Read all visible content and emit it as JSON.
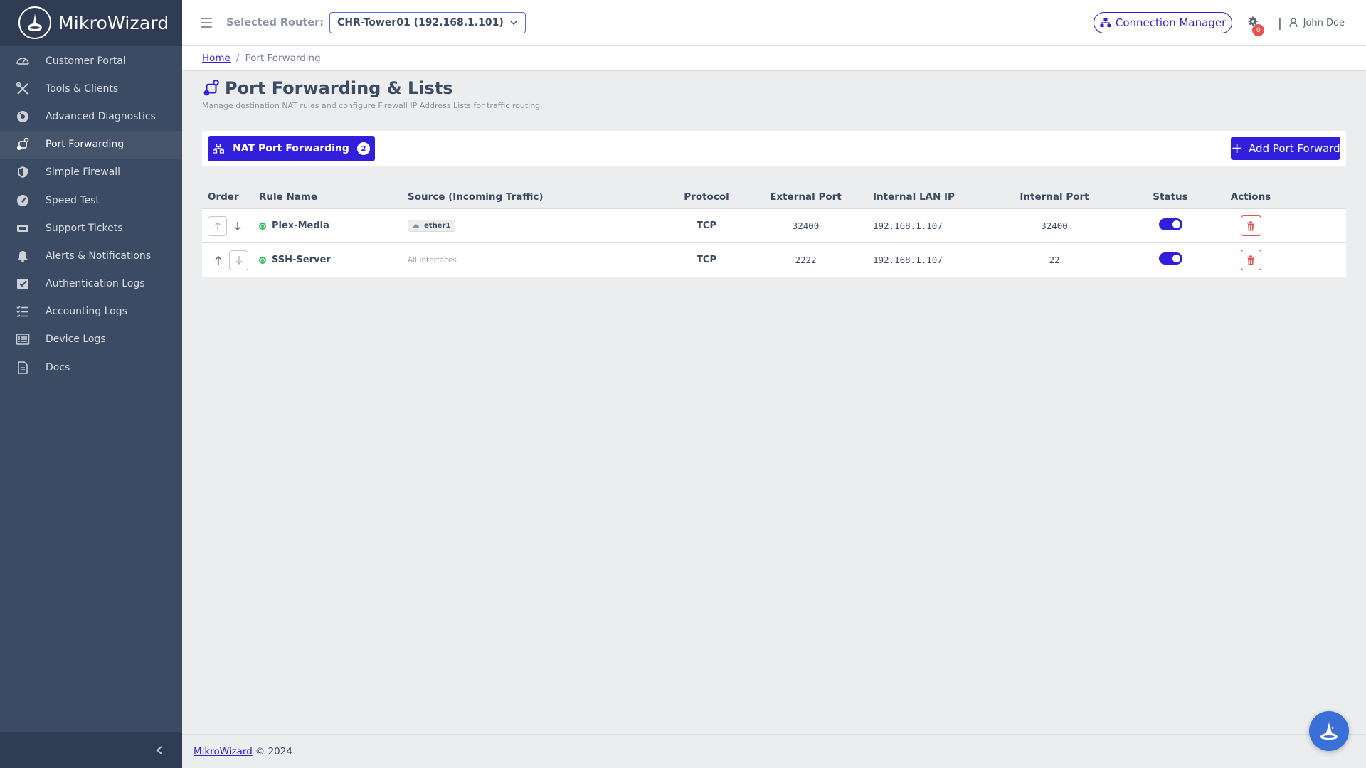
{
  "app": {
    "name": "MikroWizard"
  },
  "sidebar": {
    "items": [
      {
        "label": "Customer Portal",
        "icon": "speedometer-icon"
      },
      {
        "label": "Tools & Clients",
        "icon": "tools-icon"
      },
      {
        "label": "Advanced Diagnostics",
        "icon": "diagnostics-icon"
      },
      {
        "label": "Port Forwarding",
        "icon": "route-icon",
        "active": true
      },
      {
        "label": "Simple Firewall",
        "icon": "shield-icon"
      },
      {
        "label": "Speed Test",
        "icon": "gauge-icon"
      },
      {
        "label": "Support Tickets",
        "icon": "ticket-icon"
      },
      {
        "label": "Alerts & Notifications",
        "icon": "bell-icon"
      },
      {
        "label": "Authentication Logs",
        "icon": "auth-log-icon"
      },
      {
        "label": "Accounting Logs",
        "icon": "list-check-icon"
      },
      {
        "label": "Device Logs",
        "icon": "list-icon"
      },
      {
        "label": "Docs",
        "icon": "document-icon"
      }
    ]
  },
  "header": {
    "router_label": "Selected Router:",
    "router_value": "CHR-Tower01 (192.168.1.101)",
    "connection_manager": "Connection Manager",
    "notification_count": "0",
    "separator": "|",
    "user_name": "John Doe"
  },
  "breadcrumb": {
    "home": "Home",
    "separator": "/",
    "current": "Port Forwarding"
  },
  "page": {
    "title": "Port Forwarding & Lists",
    "subtitle": "Manage destination NAT rules and configure Firewall IP Address Lists for traffic routing."
  },
  "tabs": {
    "nat_label": "NAT Port Forwarding",
    "nat_count": "2",
    "add_label": "Add Port Forward"
  },
  "table": {
    "headers": {
      "order": "Order",
      "name": "Rule Name",
      "source": "Source (Incoming Traffic)",
      "protocol": "Protocol",
      "external_port": "External Port",
      "internal_ip": "Internal LAN IP",
      "internal_port": "Internal Port",
      "status": "Status",
      "actions": "Actions"
    },
    "rows": [
      {
        "name": "Plex-Media",
        "source": "ether1",
        "source_type": "interface",
        "protocol": "TCP",
        "external_port": "32400",
        "internal_ip": "192.168.1.107",
        "internal_port": "32400",
        "enabled": true
      },
      {
        "name": "SSH-Server",
        "source": "All Interfaces",
        "source_type": "all",
        "protocol": "TCP",
        "external_port": "2222",
        "internal_ip": "192.168.1.107",
        "internal_port": "22",
        "enabled": true
      }
    ]
  },
  "footer": {
    "brand_link": "MikroWizard",
    "copyright": "© 2024"
  },
  "colors": {
    "primary": "#321fdb",
    "sidebar": "#3c4b64",
    "danger": "#e55353",
    "success": "#2eb85c"
  }
}
